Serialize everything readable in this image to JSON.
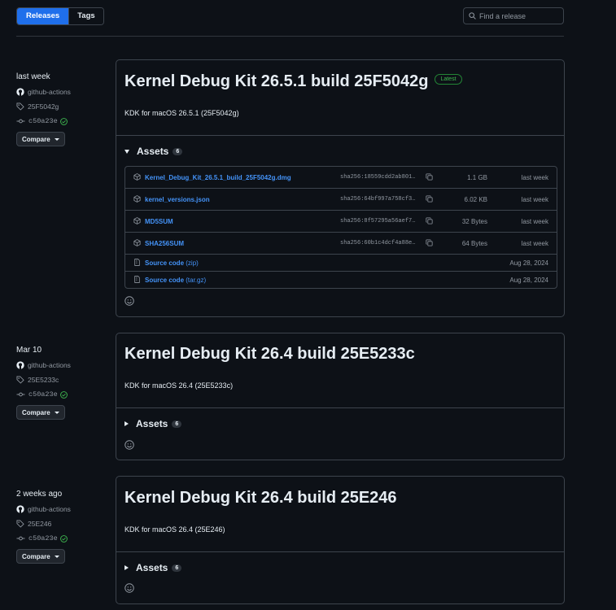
{
  "tabs": {
    "releases": "Releases",
    "tags": "Tags"
  },
  "search": {
    "placeholder": "Find a release"
  },
  "releases": [
    {
      "date": "last week",
      "author": "github-actions",
      "tag": "25F5042g",
      "commit": "c50a23e",
      "compare": "Compare",
      "title": "Kernel Debug Kit 26.5.1 build 25F5042g",
      "latest_badge": "Latest",
      "description": "KDK for macOS 26.5.1 (25F5042g)",
      "assets_label": "Assets",
      "assets_count": "6",
      "assets": [
        {
          "name": "Kernel_Debug_Kit_26.5.1_build_25F5042g.dmg",
          "sha": "sha256:18559cdd2ab801…",
          "size": "1.1 GB",
          "when": "last week"
        },
        {
          "name": "kernel_versions.json",
          "sha": "sha256:64bf997a758cf3…",
          "size": "6.02 KB",
          "when": "last week"
        },
        {
          "name": "MD5SUM",
          "sha": "sha256:8f57295a56aef7…",
          "size": "32 Bytes",
          "when": "last week"
        },
        {
          "name": "SHA256SUM",
          "sha": "sha256:60b1c4dcf4a88e…",
          "size": "64 Bytes",
          "when": "last week"
        },
        {
          "name": "Source code",
          "suffix": "(zip)",
          "when": "Aug 28, 2024"
        },
        {
          "name": "Source code",
          "suffix": "(tar.gz)",
          "when": "Aug 28, 2024"
        }
      ]
    },
    {
      "date": "Mar 10",
      "author": "github-actions",
      "tag": "25E5233c",
      "commit": "c50a23e",
      "compare": "Compare",
      "title": "Kernel Debug Kit 26.4 build 25E5233c",
      "description": "KDK for macOS 26.4 (25E5233c)",
      "assets_label": "Assets",
      "assets_count": "6"
    },
    {
      "date": "2 weeks ago",
      "author": "github-actions",
      "tag": "25E246",
      "commit": "c50a23e",
      "compare": "Compare",
      "title": "Kernel Debug Kit 26.4 build 25E246",
      "description": "KDK for macOS 26.4 (25E246)",
      "assets_label": "Assets",
      "assets_count": "6"
    }
  ]
}
